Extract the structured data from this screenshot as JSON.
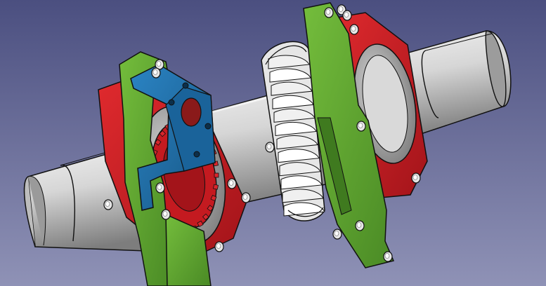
{
  "viewport": {
    "background_top": "#4b4f80",
    "background_bottom": "#8f92b6"
  },
  "colors": {
    "pipe": "#d6d6d6",
    "pipe_shadow": "#8a8a8a",
    "pipe_inner": "#a9a9a9",
    "plate_green": "#5fa531",
    "plate_green_dark": "#2f5f19",
    "flange_red": "#cf1b21",
    "flange_red_dark": "#7a0e12",
    "bearing_grey": "#9a9a9a",
    "motor_bracket_blue": "#1e6aa0",
    "motor_bracket_blue_dark": "#0f3a5c",
    "fan_white": "#f2f2f2",
    "fan_shadow": "#9c9c9c",
    "bolt": "#e9e9e9",
    "edge": "#111111"
  }
}
